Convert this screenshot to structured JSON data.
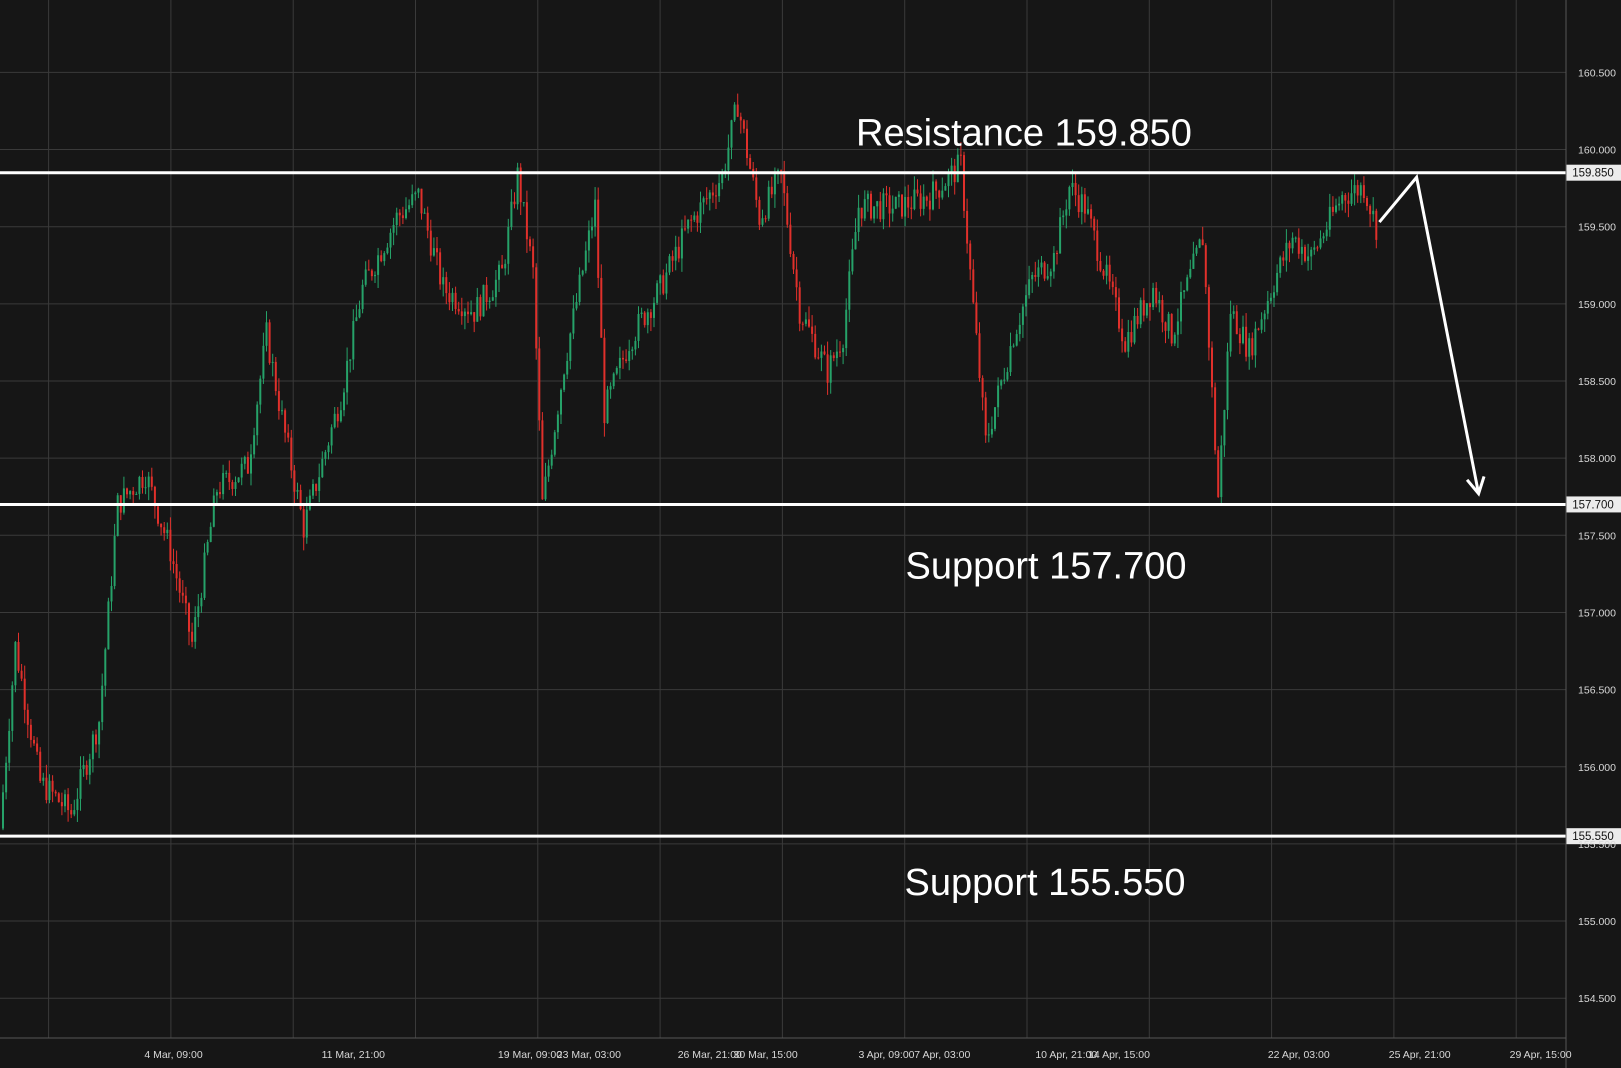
{
  "chart_data": {
    "type": "candlestick",
    "title": "",
    "colors": {
      "up": "#26a269",
      "down": "#e0302b",
      "background": "#161616",
      "grid": "#3a3a3a",
      "level_line": "#ffffff",
      "text": "#d8d8d8"
    },
    "ylim": [
      154.3,
      160.75
    ],
    "y_ticks": [
      "160.500",
      "160.000",
      "159.500",
      "159.000",
      "158.500",
      "158.000",
      "157.500",
      "157.000",
      "156.500",
      "156.000",
      "155.500",
      "155.000",
      "154.500"
    ],
    "x_ticks": [
      {
        "label": "4 Mar, 09:00",
        "idx": 55
      },
      {
        "label": "11 Mar, 21:00",
        "idx": 113
      },
      {
        "label": "19 Mar, 09:00",
        "idx": 170
      },
      {
        "label": "23 Mar, 03:00",
        "idx": 189
      },
      {
        "label": "26 Mar, 21:00",
        "idx": 228
      },
      {
        "label": "30 Mar, 15:00",
        "idx": 246
      },
      {
        "label": "3 Apr, 09:00",
        "idx": 285
      },
      {
        "label": "7 Apr, 03:00",
        "idx": 303
      },
      {
        "label": "10 Apr, 21:00",
        "idx": 343
      },
      {
        "label": "14 Apr, 15:00",
        "idx": 360
      },
      {
        "label": "22 Apr, 03:00",
        "idx": 418
      },
      {
        "label": "25 Apr, 21:00",
        "idx": 457
      },
      {
        "label": "29 Apr, 15:00",
        "idx": 496
      }
    ],
    "price_path": [
      [
        0,
        155.6
      ],
      [
        5,
        156.78
      ],
      [
        13,
        155.9
      ],
      [
        23,
        155.7
      ],
      [
        32,
        156.3
      ],
      [
        38,
        157.7
      ],
      [
        47,
        157.9
      ],
      [
        55,
        157.4
      ],
      [
        62,
        156.8
      ],
      [
        70,
        157.8
      ],
      [
        80,
        157.95
      ],
      [
        86,
        158.8
      ],
      [
        92,
        158.15
      ],
      [
        98,
        157.55
      ],
      [
        110,
        158.4
      ],
      [
        117,
        159.1
      ],
      [
        128,
        159.56
      ],
      [
        135,
        159.7
      ],
      [
        143,
        159.1
      ],
      [
        153,
        158.95
      ],
      [
        162,
        159.2
      ],
      [
        167,
        159.83
      ],
      [
        172,
        159.2
      ],
      [
        175,
        157.7
      ],
      [
        182,
        158.6
      ],
      [
        192,
        159.63
      ],
      [
        195,
        158.3
      ],
      [
        203,
        158.76
      ],
      [
        213,
        159.1
      ],
      [
        222,
        159.5
      ],
      [
        233,
        159.83
      ],
      [
        238,
        160.3
      ],
      [
        245,
        159.56
      ],
      [
        252,
        159.83
      ],
      [
        258,
        158.96
      ],
      [
        267,
        158.56
      ],
      [
        272,
        158.8
      ],
      [
        277,
        159.63
      ],
      [
        290,
        159.63
      ],
      [
        300,
        159.7
      ],
      [
        310,
        159.9
      ],
      [
        313,
        159.2
      ],
      [
        318,
        158.1
      ],
      [
        327,
        158.8
      ],
      [
        333,
        159.16
      ],
      [
        340,
        159.3
      ],
      [
        345,
        159.76
      ],
      [
        350,
        159.63
      ],
      [
        358,
        159.1
      ],
      [
        363,
        158.76
      ],
      [
        372,
        159.1
      ],
      [
        378,
        158.8
      ],
      [
        388,
        159.43
      ],
      [
        393,
        157.75
      ],
      [
        397,
        158.96
      ],
      [
        403,
        158.7
      ],
      [
        412,
        159.2
      ],
      [
        417,
        159.43
      ],
      [
        423,
        159.3
      ],
      [
        433,
        159.7
      ],
      [
        440,
        159.76
      ],
      [
        444,
        159.5
      ]
    ],
    "levels": [
      {
        "price": 159.85,
        "label": "159.850",
        "annotation": "Resistance 159.850"
      },
      {
        "price": 157.7,
        "label": "157.700",
        "annotation": "Support 157.700"
      },
      {
        "price": 155.55,
        "label": "155.550",
        "annotation": "Support 155.550"
      }
    ],
    "projection_arrow": [
      [
        444,
        159.53
      ],
      [
        456,
        159.82
      ],
      [
        476,
        157.77
      ]
    ]
  }
}
